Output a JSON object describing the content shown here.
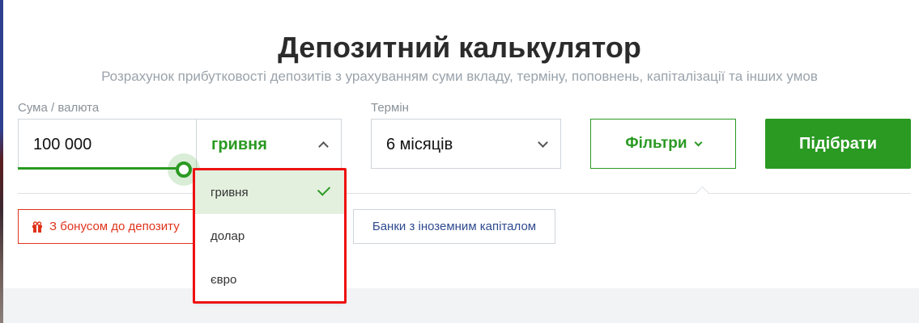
{
  "header": {
    "title": "Депозитний калькулятор",
    "subtitle": "Розрахунок прибутковості депозитів з урахуванням суми вкладу, терміну, поповнень, капіталізації та інших умов"
  },
  "form": {
    "amount_label": "Сума / валюта",
    "amount_value": "100 000",
    "currency_selected": "гривня",
    "currency_options": [
      "гривня",
      "долар",
      "євро"
    ],
    "term_label": "Термін",
    "term_value": "6 місяців",
    "filters_label": "Фільтри",
    "submit_label": "Підібрати"
  },
  "filter_chips": {
    "bonus": "З бонусом до депозиту",
    "foreign_banks": "Банки з іноземним капіталом"
  },
  "icons": {
    "bonus": "gift-icon",
    "selected_option": "check-icon",
    "dropdown_open": "chevron-up-icon",
    "term_select": "chevron-down-icon"
  },
  "colors": {
    "accent_green": "#2a9a22",
    "bonus_red": "#e0331c",
    "highlight_red": "#ee1111",
    "link_blue": "#2e4a8f"
  }
}
